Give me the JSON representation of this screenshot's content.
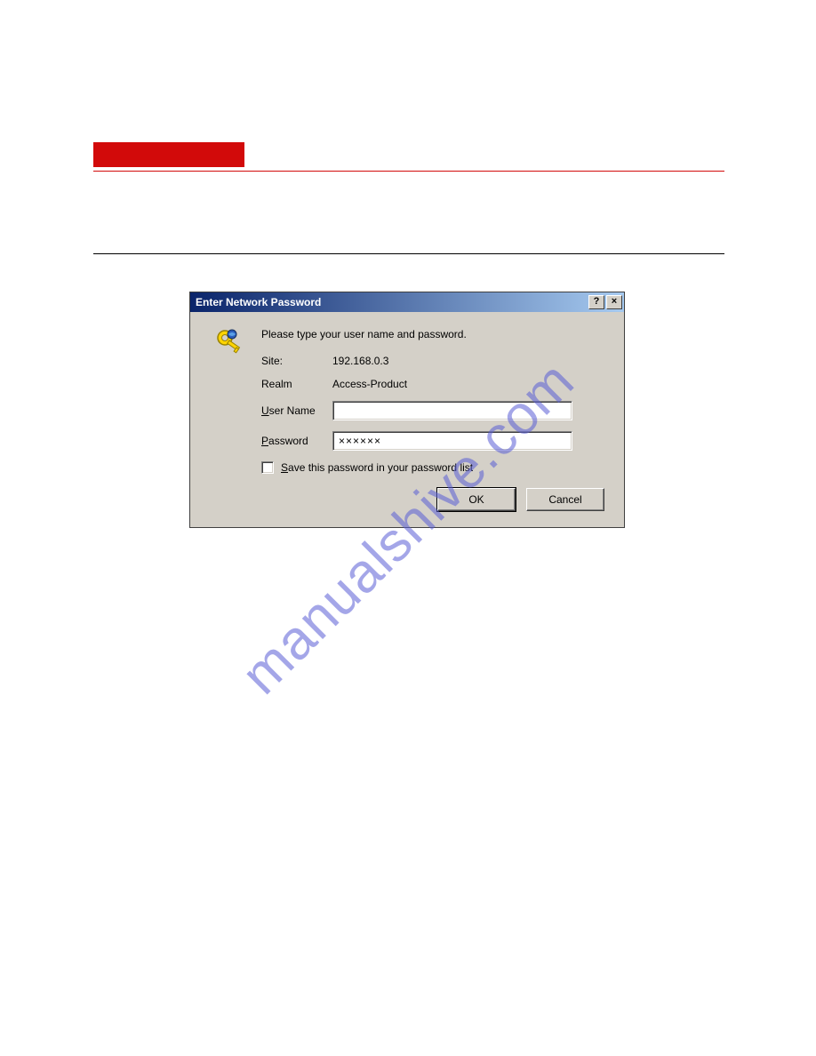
{
  "watermark": "manualshive.com",
  "dialog": {
    "title": "Enter Network Password",
    "prompt": "Please type your user name and password.",
    "help_glyph": "?",
    "close_glyph": "×",
    "site_label": "Site:",
    "site_value": "192.168.0.3",
    "realm_label": "Realm",
    "realm_value": "Access-Product",
    "username_label_pre": "",
    "username_label_u": "U",
    "username_label_post": "ser Name",
    "username_value": "",
    "password_label_pre": "",
    "password_label_u": "P",
    "password_label_post": "assword",
    "password_value": "××××××",
    "save_label_pre": "",
    "save_label_u": "S",
    "save_label_post": "ave this password in your password list",
    "ok_label": "OK",
    "cancel_label": "Cancel"
  }
}
